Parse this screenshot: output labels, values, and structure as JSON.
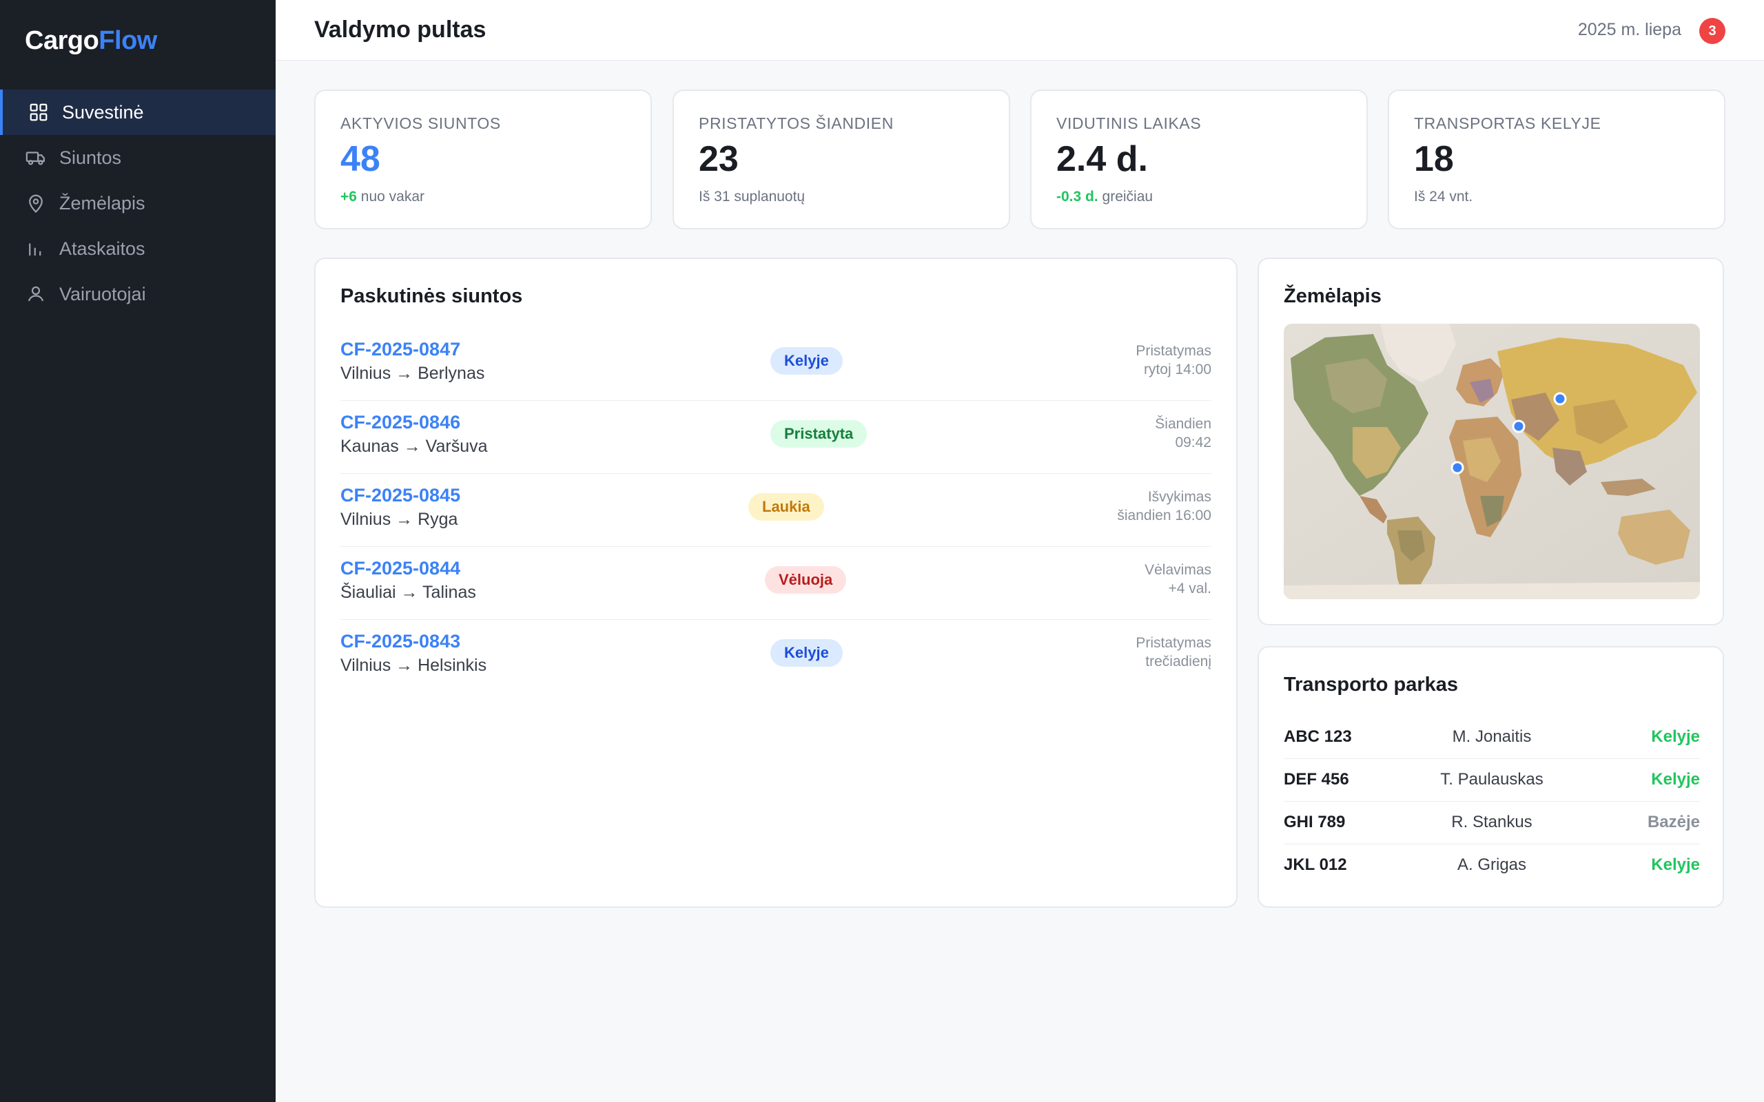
{
  "brand": {
    "name_part1": "Cargo",
    "name_part2": "Flow",
    "accent_color": "#3b82f6"
  },
  "sidebar": {
    "items": [
      {
        "label": "Suvestinė",
        "icon": "grid-icon",
        "active": true
      },
      {
        "label": "Siuntos",
        "icon": "truck-icon",
        "active": false
      },
      {
        "label": "Žemėlapis",
        "icon": "map-pin-icon",
        "active": false
      },
      {
        "label": "Ataskaitos",
        "icon": "bar-chart-icon",
        "active": false
      },
      {
        "label": "Vairuotojai",
        "icon": "user-icon",
        "active": false
      }
    ]
  },
  "header": {
    "title": "Valdymo pultas",
    "date": "2025 m. liepa",
    "notifications": "3"
  },
  "stats": [
    {
      "label": "Aktyvios siuntos",
      "value": "48",
      "sub_highlight": "+6",
      "sub_text": " nuo vakar"
    },
    {
      "label": "Pristatytos šiandien",
      "value": "23",
      "sub_highlight": "",
      "sub_text": "Iš 31 suplanuotų"
    },
    {
      "label": "Vidutinis laikas",
      "value": "2.4 d.",
      "sub_highlight": "-0.3 d.",
      "sub_text": " greičiau"
    },
    {
      "label": "Transportas kelyje",
      "value": "18",
      "sub_highlight": "",
      "sub_text": "Iš 24 vnt."
    }
  ],
  "shipments": {
    "title": "Paskutinės siuntos",
    "rows": [
      {
        "id": "CF-2025-0847",
        "route": "Vilnius → Berlynas",
        "status": "Kelyje",
        "status_color": "blue",
        "eta_line1": "Pristatymas",
        "eta_line2": "rytoj 14:00"
      },
      {
        "id": "CF-2025-0846",
        "route": "Kaunas → Varšuva",
        "status": "Pristatyta",
        "status_color": "green",
        "eta_line1": "Šiandien",
        "eta_line2": "09:42"
      },
      {
        "id": "CF-2025-0845",
        "route": "Vilnius → Ryga",
        "status": "Laukia",
        "status_color": "yellow",
        "eta_line1": "Išvykimas",
        "eta_line2": "šiandien 16:00"
      },
      {
        "id": "CF-2025-0844",
        "route": "Šiauliai → Talinas",
        "status": "Vėluoja",
        "status_color": "red",
        "eta_line1": "Vėlavimas",
        "eta_line2": "+4 val."
      },
      {
        "id": "CF-2025-0843",
        "route": "Vilnius → Helsinkis",
        "status": "Kelyje",
        "status_color": "blue",
        "eta_line1": "Pristatymas",
        "eta_line2": "trečiadienį"
      }
    ]
  },
  "map": {
    "title": "Žemėlapis"
  },
  "fleet": {
    "title": "Transporto parkas",
    "rows": [
      {
        "plate": "ABC 123",
        "driver": "M. Jonaitis",
        "status": "Kelyje",
        "status_color": "green"
      },
      {
        "plate": "DEF 456",
        "driver": "T. Paulauskas",
        "status": "Kelyje",
        "status_color": "green"
      },
      {
        "plate": "GHI 789",
        "driver": "R. Stankus",
        "status": "Bazėje",
        "status_color": "gray"
      },
      {
        "plate": "JKL 012",
        "driver": "A. Grigas",
        "status": "Kelyje",
        "status_color": "green"
      }
    ]
  }
}
